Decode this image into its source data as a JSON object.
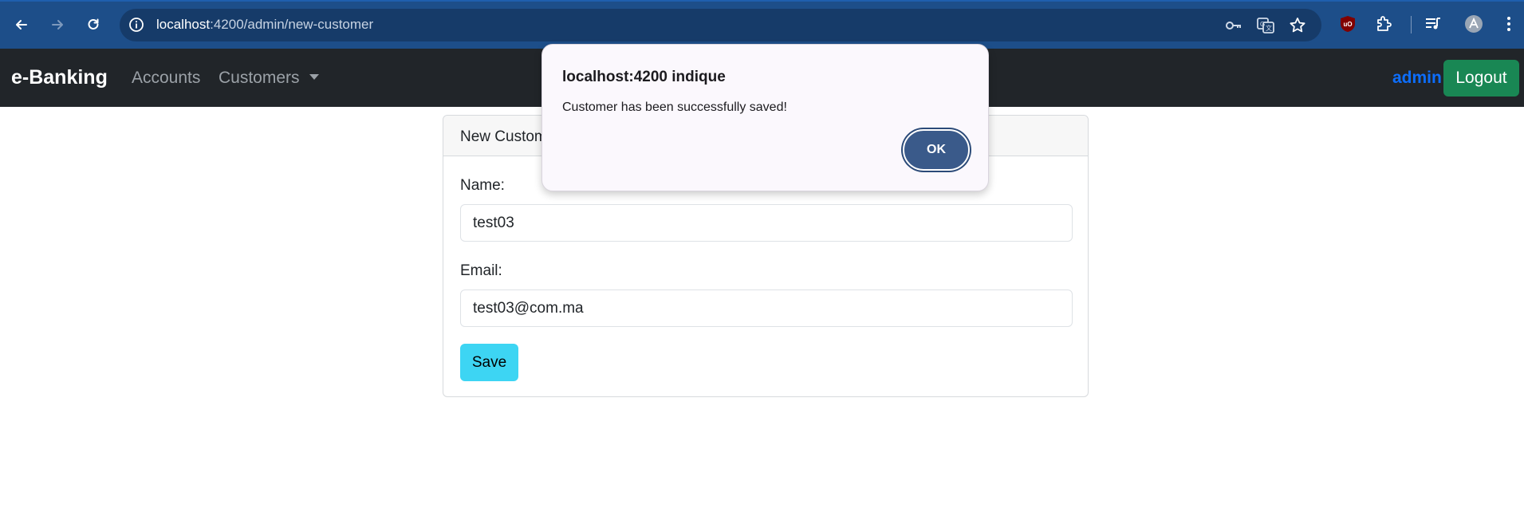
{
  "browser": {
    "url_host": "localhost",
    "url_path": ":4200/admin/new-customer"
  },
  "navbar": {
    "brand": "e-Banking",
    "accounts": "Accounts",
    "customers": "Customers",
    "user": "admin",
    "logout": "Logout"
  },
  "form": {
    "card_title": "New Customer",
    "name_label": "Name:",
    "name_value": "test03",
    "email_label": "Email:",
    "email_value": "test03@com.ma",
    "save_label": "Save"
  },
  "dialog": {
    "title": "localhost:4200 indique",
    "message": "Customer has been successfully saved!",
    "ok_label": "OK"
  },
  "icons": {
    "back": "arrow-left-icon",
    "forward": "arrow-right-icon",
    "reload": "reload-icon",
    "site_info": "info-icon",
    "password": "key-icon",
    "translate": "translate-icon",
    "bookmark": "star-icon",
    "ublock": "ublock-icon",
    "extensions": "puzzle-icon",
    "media": "media-queue-icon",
    "profile": "profile-icon",
    "menu": "kebab-menu-icon"
  },
  "colors": {
    "browser_bar": "#1d4e89",
    "navbar": "#212529",
    "admin": "#0d6efd",
    "logout": "#198754",
    "save": "#3dd5f3",
    "ok_button": "#3a5a8a"
  }
}
